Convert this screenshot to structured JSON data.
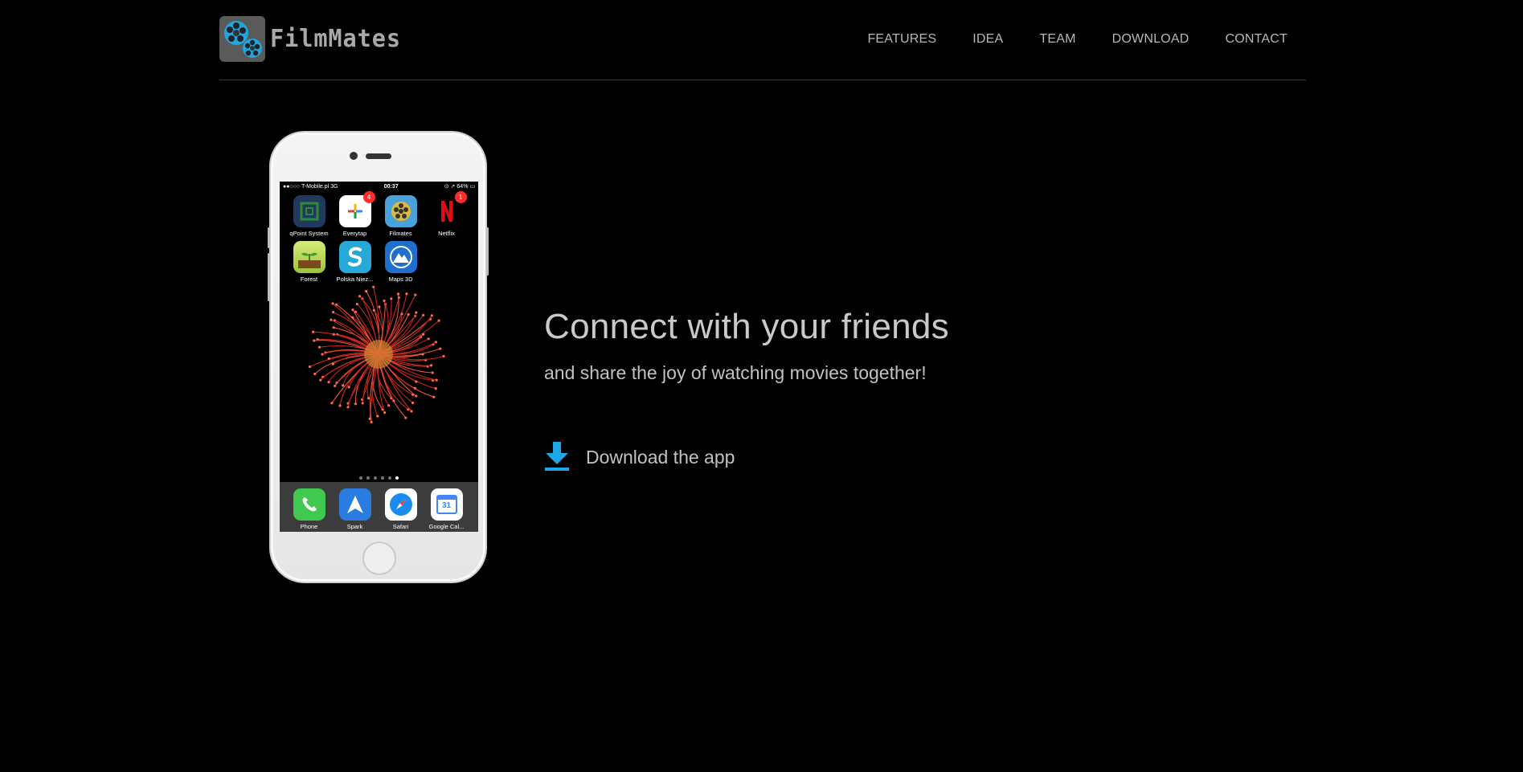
{
  "brand": {
    "name": "FilmMates",
    "logo_icon": "film-reel-icon"
  },
  "nav": {
    "items": [
      {
        "label": "FEATURES"
      },
      {
        "label": "IDEA"
      },
      {
        "label": "TEAM"
      },
      {
        "label": "DOWNLOAD"
      },
      {
        "label": "CONTACT"
      }
    ]
  },
  "phone": {
    "status": {
      "carrier": "●●○○○ T-Mobile.pl  3G",
      "time": "00:37",
      "battery": "⊙ ➚ 64% ▭"
    },
    "apps": [
      {
        "label": "qPoint System",
        "icon": "qpoint-icon",
        "color": "#1f3a5c"
      },
      {
        "label": "Everytap",
        "icon": "everytap-icon",
        "color": "#ffffff",
        "badge": "4"
      },
      {
        "label": "Filmates",
        "icon": "filmates-icon",
        "color": "#4aa3d8"
      },
      {
        "label": "Netflix",
        "icon": "netflix-icon",
        "color": "#000000",
        "badge": "1"
      },
      {
        "label": "Forest",
        "icon": "forest-icon",
        "color": "#c9e26a"
      },
      {
        "label": "Polska Niez...",
        "icon": "polska-icon",
        "color": "#27a9d8"
      },
      {
        "label": "Maps 3D",
        "icon": "maps3d-icon",
        "color": "#1e6fd0"
      }
    ],
    "dock": [
      {
        "label": "Phone",
        "icon": "phone-icon",
        "color": "#3fc94f"
      },
      {
        "label": "Spark",
        "icon": "spark-icon",
        "color": "#2a7ce0"
      },
      {
        "label": "Safari",
        "icon": "safari-icon",
        "color": "#ffffff"
      },
      {
        "label": "Google Cal...",
        "icon": "calendar-icon",
        "color": "#ffffff",
        "date": "31"
      }
    ]
  },
  "hero": {
    "title": "Connect with your friends",
    "subtitle": "and share the joy of watching movies together!",
    "download_label": "Download the app",
    "download_icon": "download-icon",
    "accent": "#1ea7e6"
  }
}
